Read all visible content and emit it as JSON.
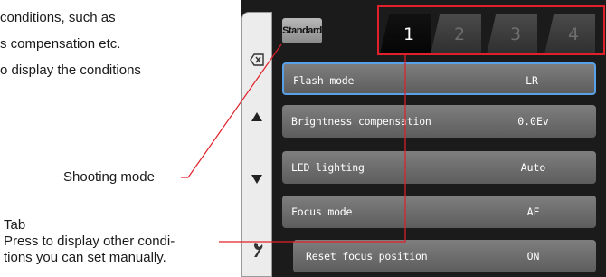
{
  "description": {
    "line1": "conditions, such as",
    "line2": "s compensation etc.",
    "line3": "o display the conditions"
  },
  "callouts": {
    "shooting_mode": "Shooting mode",
    "tab_title": "Tab",
    "tab_desc_line1": "Press to display other condi-",
    "tab_desc_line2": "tions you can set manually."
  },
  "camera": {
    "shooting_mode_label": "Standard",
    "tabs": [
      "1",
      "2",
      "3",
      "4"
    ],
    "active_tab": "1",
    "settings": [
      {
        "label": "Flash mode",
        "value": "LR"
      },
      {
        "label": "Brightness compensation",
        "value": "0.0Ev"
      },
      {
        "label": "LED lighting",
        "value": "Auto"
      },
      {
        "label": "Focus mode",
        "value": "AF"
      },
      {
        "label": "Reset focus position",
        "value": "ON"
      }
    ],
    "sidebar_icons": [
      "backspace-icon",
      "up-arrow-icon",
      "down-arrow-icon",
      "wrench-icon"
    ]
  },
  "colors": {
    "highlight_box": "#e0202a",
    "selected_row_border": "#58a0e8"
  }
}
